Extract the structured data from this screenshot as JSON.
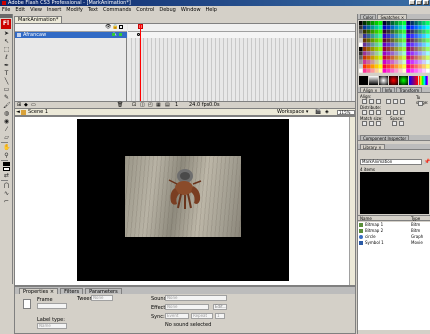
{
  "window": {
    "title": "Adobe Flash CS3 Professional - [MarkAnimation*]",
    "controls": [
      "_",
      "□",
      "x"
    ]
  },
  "menu": [
    "File",
    "Edit",
    "View",
    "Insert",
    "Modify",
    "Text",
    "Commands",
    "Control",
    "Debug",
    "Window",
    "Help"
  ],
  "document_tab": "MarkAnimation*",
  "timeline": {
    "layer_name": "Afrancaw",
    "status_frame": "1",
    "status_fps": "24.0 fps",
    "status_time": "0.0s"
  },
  "editbar": {
    "scene": "Scene 1",
    "workspace": "Workspace ▾",
    "zoom": "115%"
  },
  "properties": {
    "tabs": [
      "Properties ×",
      "Filters",
      "Parameters"
    ],
    "frame_label": "Frame",
    "tween_label": "Tween:",
    "tween_value": "None",
    "label_type_label": "Label type:",
    "label_type_value": "Name",
    "sound_label": "Sound:",
    "sound_value": "None",
    "effect_label": "Effect:",
    "effect_value": "None",
    "edit_label": "Edit...",
    "sync_label": "Sync:",
    "sync_value": "Event",
    "repeat_value": "Repeat",
    "repeat_count": "1",
    "status": "No sound selected"
  },
  "right": {
    "color_tabs": [
      "Color",
      "Swatches ×"
    ],
    "align_tabs": [
      "Align ×",
      "Info",
      "Transform"
    ],
    "align_label": "Align:",
    "distribute_label": "Distribute:",
    "match_size_label": "Match size:",
    "space_label": "Space:",
    "to_stage_label": "To stage:",
    "component_tab": "Component Inspector",
    "library_tab": "Library ×",
    "library_doc": "MarkAnimation",
    "library_count": "4 items",
    "library_col_name": "Name",
    "library_col_type": "Type",
    "library_items": [
      {
        "name": "Bitmap 1",
        "type": "Bitm"
      },
      {
        "name": "Bitmap 2",
        "type": "Bitm"
      },
      {
        "name": "circle",
        "type": "Graph"
      },
      {
        "name": "Symbol 1",
        "type": "Movie"
      }
    ]
  },
  "colors": {
    "titlebar": "#0a246a",
    "layer_selected": "#316ac5",
    "playhead": "#ff0000",
    "stage": "#000000"
  }
}
